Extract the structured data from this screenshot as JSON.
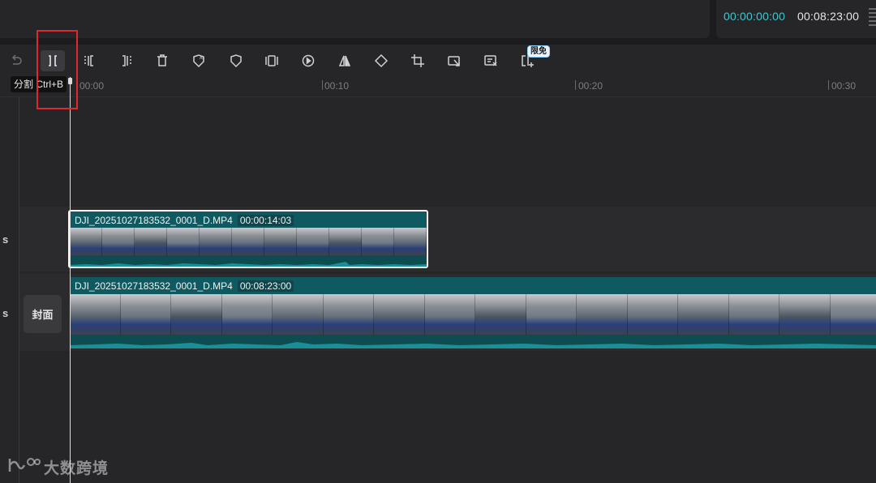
{
  "player": {
    "current_time": "00:00:00:00",
    "total_time": "00:08:23:00"
  },
  "toolbar": {
    "tools": [
      {
        "name": "redo-icon"
      },
      {
        "name": "split-icon"
      },
      {
        "name": "split-left-icon"
      },
      {
        "name": "split-right-icon"
      },
      {
        "name": "delete-icon"
      },
      {
        "name": "ai-mask-icon"
      },
      {
        "name": "mask-icon"
      },
      {
        "name": "freeze-frame-icon"
      },
      {
        "name": "speed-icon"
      },
      {
        "name": "mirror-icon"
      },
      {
        "name": "rotate-icon"
      },
      {
        "name": "crop-icon"
      },
      {
        "name": "resize-icon"
      },
      {
        "name": "remove-bg-icon"
      },
      {
        "name": "smart-edit-icon"
      }
    ],
    "badge_label": "限免",
    "tooltip": "分割 Ctrl+B"
  },
  "ruler": {
    "labels": [
      "00:00",
      "00:10",
      "00:20",
      "00:30"
    ]
  },
  "tracks": {
    "track1_label": "s",
    "track2_label": "s",
    "cover_label": "封面"
  },
  "clips": [
    {
      "filename": "DJI_20251027183532_0001_D.MP4",
      "duration": "00:00:14:03",
      "selected": true
    },
    {
      "filename": "DJI_20251027183532_0001_D.MP4",
      "duration": "00:08:23:00",
      "selected": false
    }
  ],
  "watermark": {
    "text": "大数跨境"
  },
  "colors": {
    "accent": "#3dc8cf",
    "clip_bg": "#0f5a60",
    "highlight": "#e0282e"
  }
}
